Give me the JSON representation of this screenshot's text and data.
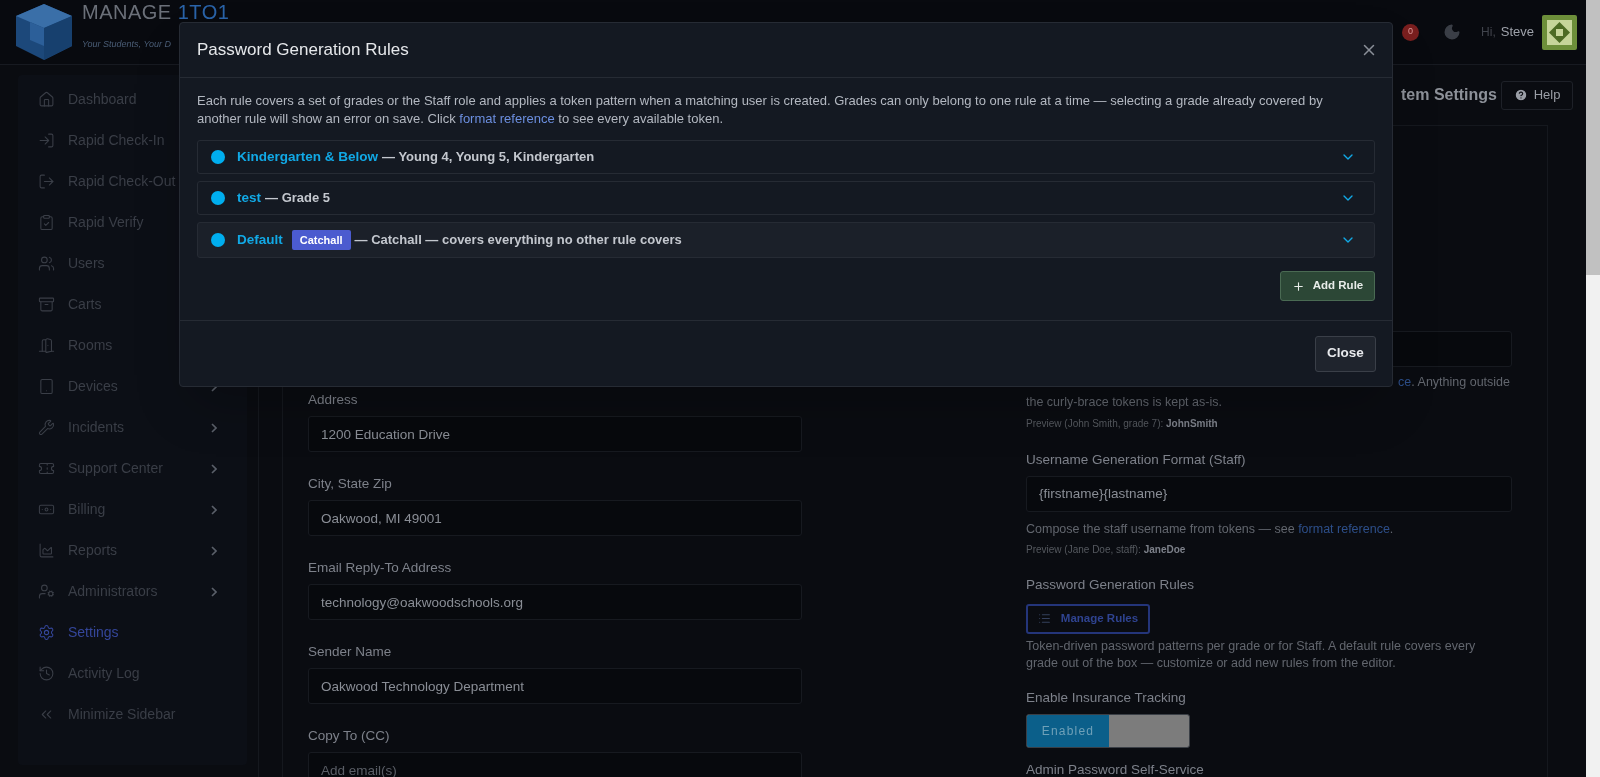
{
  "header": {
    "logo": {
      "word": "MANAGE",
      "accent": "1TO1",
      "tagline": "Your Students, Your D"
    },
    "notifications": "0",
    "greeting": "Hi,",
    "user": "Steve"
  },
  "sidebar": {
    "items": [
      {
        "label": "Dashboard",
        "selected": false
      },
      {
        "label": "Rapid Check-In",
        "selected": false
      },
      {
        "label": "Rapid Check-Out",
        "selected": false
      },
      {
        "label": "Rapid Verify",
        "selected": false
      },
      {
        "label": "Users",
        "selected": false
      },
      {
        "label": "Carts",
        "selected": false
      },
      {
        "label": "Rooms",
        "selected": false
      },
      {
        "label": "Devices",
        "selected": false,
        "submenu": true
      },
      {
        "label": "Incidents",
        "selected": false,
        "submenu": true
      },
      {
        "label": "Support Center",
        "selected": false,
        "submenu": true
      },
      {
        "label": "Billing",
        "selected": false,
        "submenu": true
      },
      {
        "label": "Reports",
        "selected": false,
        "submenu": true
      },
      {
        "label": "Administrators",
        "selected": false,
        "submenu": true
      },
      {
        "label": "Settings",
        "selected": true,
        "submenu": false
      },
      {
        "label": "Activity Log",
        "selected": false,
        "submenu": false
      },
      {
        "label": "Minimize Sidebar",
        "selected": false,
        "submenu": false
      }
    ]
  },
  "page": {
    "title": "tem Settings",
    "help": "Help"
  },
  "left_fields": [
    {
      "label": "Address",
      "value": "1200 Education Drive"
    },
    {
      "label": "City, State Zip",
      "value": "Oakwood, MI 49001"
    },
    {
      "label": "Email Reply-To Address",
      "value": "technology@oakwoodschools.org"
    },
    {
      "label": "Sender Name",
      "value": "Oakwood Technology Department"
    },
    {
      "label": "Copy To (CC)",
      "placeholder": "Add email(s)"
    }
  ],
  "right_column": {
    "student_format_help": {
      "link": "ce",
      "text": ". Anything outside",
      "line2": "the curly-brace tokens is kept as-is.",
      "preview_label": "Preview (John Smith, grade 7):",
      "preview_value": "JohnSmith"
    },
    "staff_format": {
      "label": "Username Generation Format (Staff)",
      "value": "{firstname}{lastname}",
      "help_before": "Compose the staff username from tokens — see ",
      "help_link": "format reference",
      "help_after": ".",
      "preview_label": "Preview (Jane Doe, staff):",
      "preview_value": "JaneDoe"
    },
    "password_rules": {
      "label": "Password Generation Rules",
      "button": "Manage Rules",
      "help": "Token-driven password patterns per grade or for Staff. A default rule covers every grade out of the box — customize or add new rules from the editor."
    },
    "insurance": {
      "label": "Enable Insurance Tracking",
      "toggle_text": "Enabled",
      "on": true
    },
    "self_service": {
      "label": "Admin Password Self-Service"
    }
  },
  "modal": {
    "title": "Password Generation Rules",
    "description_before": "Each rule covers a set of grades or the Staff role and applies a token pattern when a matching user is created. Grades can only belong to one rule at a time — selecting a grade already covered by another rule will show an error on save. Click ",
    "description_link": "format reference",
    "description_after": " to see every available token.",
    "rules": [
      {
        "name": "Kindergarten & Below",
        "detail": "— Young 4, Young 5, Kindergarten",
        "color": "#00aeef",
        "expanded": false,
        "highlighted": false
      },
      {
        "name": "test",
        "detail": "— Grade 5",
        "color": "#00aeef",
        "expanded": false,
        "highlighted": false
      },
      {
        "name": "Default",
        "badge": "Catchall",
        "detail": "— Catchall — covers everything no other rule covers",
        "color": "#00aeef",
        "expanded": false,
        "highlighted": true
      }
    ],
    "add_button": "Add Rule",
    "close_button": "Close"
  }
}
